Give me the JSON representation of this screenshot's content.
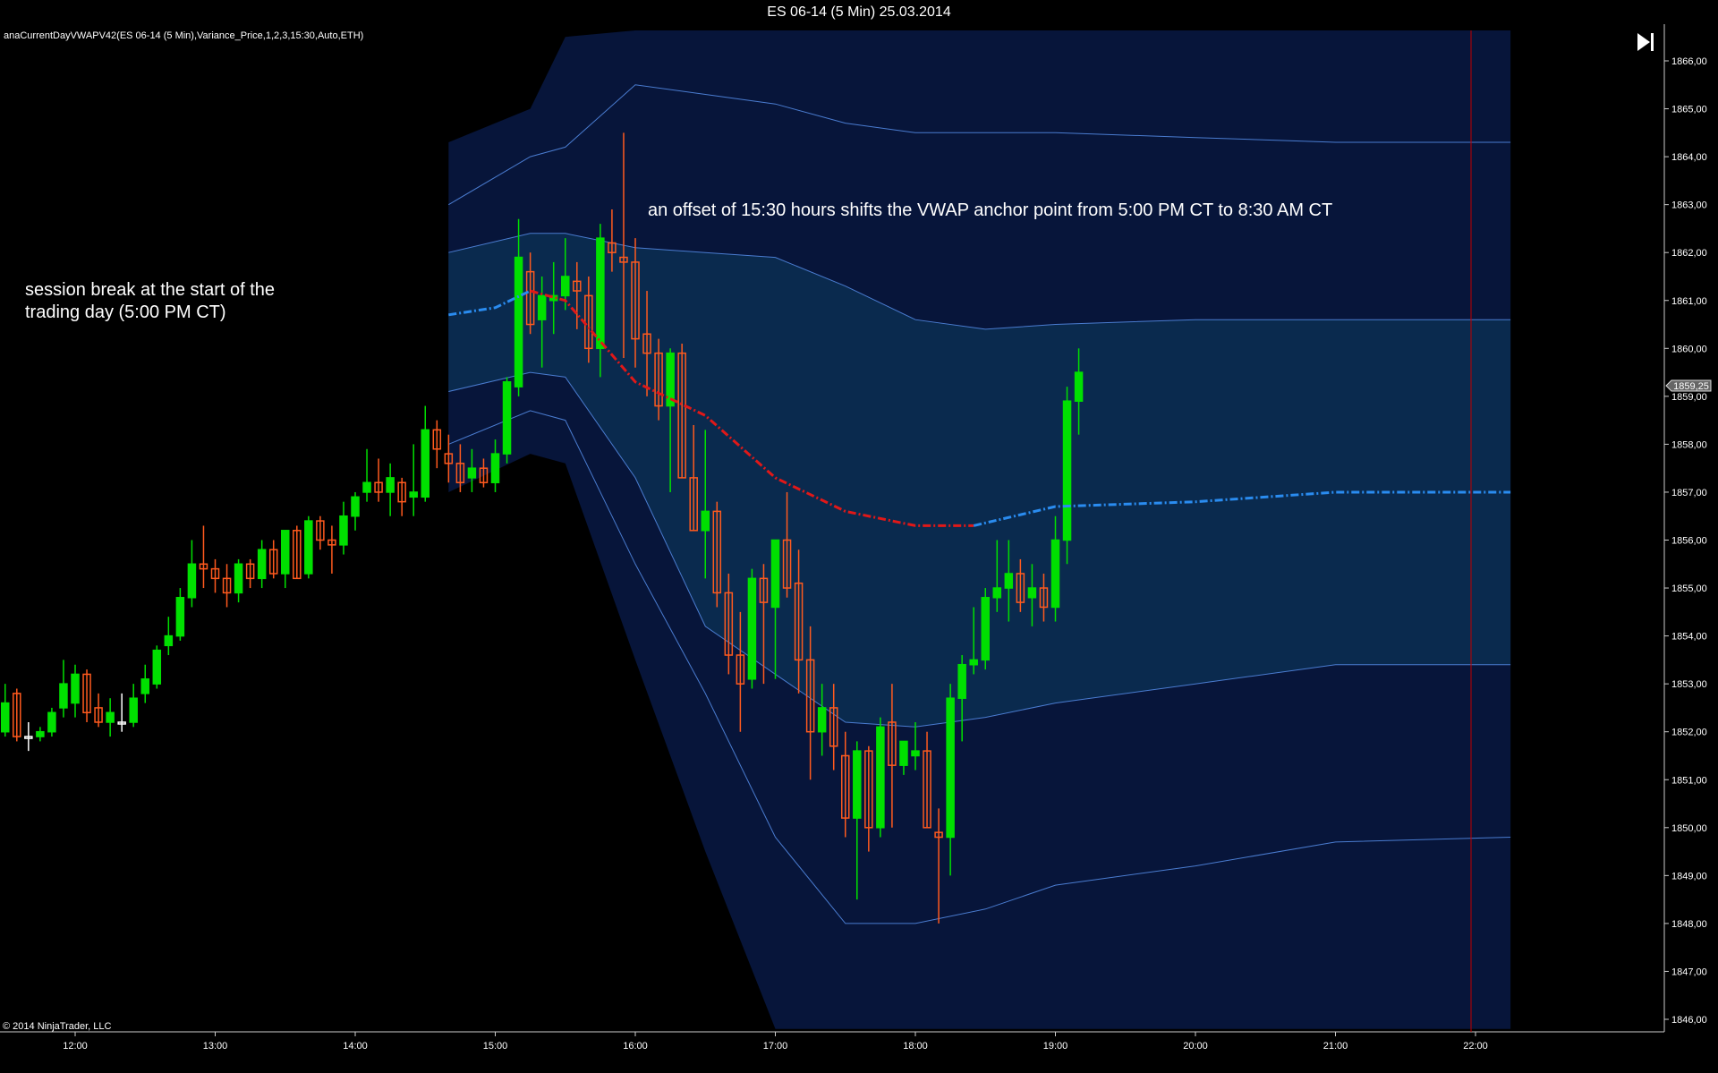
{
  "window_title": "ES 06-14 (5 Min)  25.03.2014",
  "indicator_label": "anaCurrentDayVWAPV42(ES 06-14 (5 Min),Variance_Price,1,2,3,15:30,Auto,ETH)",
  "copyright": "© 2014 NinjaTrader, LLC",
  "go_to_end_icon": "skip-to-end-icon",
  "annotations": {
    "session_break": [
      "session break at the start of the",
      "trading day (5:00 PM CT)"
    ],
    "offset_note": "an offset of 15:30 hours shifts the VWAP anchor point from 5:00 PM CT to 8:30 AM CT"
  },
  "colors": {
    "background": "#000000",
    "up_candle": "#00e000",
    "down_candle": "#ff5a1e",
    "doji_candle": "#ffffff",
    "vwap_before_offset": "#e01818",
    "vwap_after": "#2a8cf0",
    "inner_band": "#0a2a4e",
    "outer_band": "#07153a",
    "band_line": "#4a7cd0",
    "cursor_line": "#c00000"
  },
  "chart_data": {
    "type": "candlestick",
    "interval": "5 Min",
    "x_tick_labels": [
      "12:00",
      "13:00",
      "14:00",
      "15:00",
      "16:00",
      "17:00",
      "18:00",
      "19:00",
      "20:00",
      "21:00",
      "22:00"
    ],
    "y_tick_labels": [
      "1846,00",
      "1847,00",
      "1848,00",
      "1849,00",
      "1850,00",
      "1851,00",
      "1852,00",
      "1853,00",
      "1854,00",
      "1855,00",
      "1856,00",
      "1857,00",
      "1858,00",
      "1859,00",
      "1860,00",
      "1861,00",
      "1862,00",
      "1863,00",
      "1864,00",
      "1865,00",
      "1866,00"
    ],
    "ylim": [
      1845.8,
      1867.0
    ],
    "last_price": "1859,25",
    "vwap": [
      {
        "t": "14:40",
        "v": 1860.7
      },
      {
        "t": "15:00",
        "v": 1860.85
      },
      {
        "t": "15:15",
        "v": 1861.2
      },
      {
        "t": "15:30",
        "v": 1861.0
      },
      {
        "t": "16:00",
        "v": 1859.3
      },
      {
        "t": "16:30",
        "v": 1858.6
      },
      {
        "t": "17:00",
        "v": 1857.3
      },
      {
        "t": "17:30",
        "v": 1856.6
      },
      {
        "t": "18:00",
        "v": 1856.3
      },
      {
        "t": "18:25",
        "v": 1856.3
      },
      {
        "t": "19:00",
        "v": 1856.7
      },
      {
        "t": "20:00",
        "v": 1856.8
      },
      {
        "t": "21:00",
        "v": 1857.0
      },
      {
        "t": "22:15",
        "v": 1857.0
      }
    ],
    "band_1": [
      {
        "t": "14:40",
        "lo": 1859.1,
        "hi": 1862.0
      },
      {
        "t": "15:15",
        "lo": 1859.5,
        "hi": 1862.4
      },
      {
        "t": "15:30",
        "lo": 1859.4,
        "hi": 1862.4
      },
      {
        "t": "16:00",
        "lo": 1857.3,
        "hi": 1862.1
      },
      {
        "t": "16:30",
        "lo": 1854.2,
        "hi": 1862.0
      },
      {
        "t": "17:00",
        "lo": 1853.2,
        "hi": 1861.9
      },
      {
        "t": "17:30",
        "lo": 1852.2,
        "hi": 1861.3
      },
      {
        "t": "18:00",
        "lo": 1852.1,
        "hi": 1860.6
      },
      {
        "t": "18:30",
        "lo": 1852.3,
        "hi": 1860.4
      },
      {
        "t": "19:00",
        "lo": 1852.6,
        "hi": 1860.5
      },
      {
        "t": "20:00",
        "lo": 1853.0,
        "hi": 1860.6
      },
      {
        "t": "21:00",
        "lo": 1853.4,
        "hi": 1860.6
      },
      {
        "t": "22:15",
        "lo": 1853.4,
        "hi": 1860.6
      }
    ],
    "band_2": [
      {
        "t": "14:40",
        "lo": 1858.0,
        "hi": 1863.0
      },
      {
        "t": "15:15",
        "lo": 1858.7,
        "hi": 1864.0
      },
      {
        "t": "15:30",
        "lo": 1858.5,
        "hi": 1864.2
      },
      {
        "t": "16:00",
        "lo": 1855.5,
        "hi": 1865.5
      },
      {
        "t": "16:30",
        "lo": 1852.8,
        "hi": 1865.3
      },
      {
        "t": "17:00",
        "lo": 1849.8,
        "hi": 1865.1
      },
      {
        "t": "17:30",
        "lo": 1848.0,
        "hi": 1864.7
      },
      {
        "t": "18:00",
        "lo": 1848.0,
        "hi": 1864.5
      },
      {
        "t": "18:30",
        "lo": 1848.3,
        "hi": 1864.5
      },
      {
        "t": "19:00",
        "lo": 1848.8,
        "hi": 1864.5
      },
      {
        "t": "20:00",
        "lo": 1849.2,
        "hi": 1864.4
      },
      {
        "t": "21:00",
        "lo": 1849.7,
        "hi": 1864.3
      },
      {
        "t": "22:15",
        "lo": 1849.8,
        "hi": 1864.3
      }
    ],
    "band_3": [
      {
        "t": "14:40",
        "lo": 1857.0,
        "hi": 1864.3
      },
      {
        "t": "15:15",
        "lo": 1857.8,
        "hi": 1865.0
      },
      {
        "t": "15:30",
        "lo": 1857.6,
        "hi": 1866.5
      },
      {
        "t": "16:00",
        "lo": 1853.5,
        "hi": 1867.0
      },
      {
        "t": "16:30",
        "lo": 1849.5,
        "hi": 1867.0
      },
      {
        "t": "17:00",
        "lo": 1845.8,
        "hi": 1867.0
      },
      {
        "t": "22:15",
        "lo": 1845.8,
        "hi": 1867.0
      }
    ],
    "candles": [
      {
        "t": "11:30",
        "o": 1852.0,
        "h": 1853.0,
        "l": 1851.9,
        "c": 1852.6
      },
      {
        "t": "11:35",
        "o": 1852.8,
        "h": 1852.9,
        "l": 1851.8,
        "c": 1851.9
      },
      {
        "t": "11:40",
        "o": 1851.9,
        "h": 1852.2,
        "l": 1851.6,
        "c": 1851.9
      },
      {
        "t": "11:45",
        "o": 1851.9,
        "h": 1852.1,
        "l": 1851.8,
        "c": 1852.0
      },
      {
        "t": "11:50",
        "o": 1852.0,
        "h": 1852.5,
        "l": 1851.9,
        "c": 1852.4
      },
      {
        "t": "11:55",
        "o": 1852.5,
        "h": 1853.5,
        "l": 1852.3,
        "c": 1853.0
      },
      {
        "t": "12:00",
        "o": 1852.6,
        "h": 1853.4,
        "l": 1852.3,
        "c": 1853.2
      },
      {
        "t": "12:05",
        "o": 1853.2,
        "h": 1853.3,
        "l": 1852.2,
        "c": 1852.4
      },
      {
        "t": "12:10",
        "o": 1852.5,
        "h": 1852.8,
        "l": 1852.1,
        "c": 1852.2
      },
      {
        "t": "12:15",
        "o": 1852.2,
        "h": 1852.7,
        "l": 1851.9,
        "c": 1852.4
      },
      {
        "t": "12:20",
        "o": 1852.2,
        "h": 1852.8,
        "l": 1852.0,
        "c": 1852.2
      },
      {
        "t": "12:25",
        "o": 1852.2,
        "h": 1853.0,
        "l": 1852.1,
        "c": 1852.7
      },
      {
        "t": "12:30",
        "o": 1852.8,
        "h": 1853.4,
        "l": 1852.6,
        "c": 1853.1
      },
      {
        "t": "12:35",
        "o": 1853.0,
        "h": 1853.8,
        "l": 1852.9,
        "c": 1853.7
      },
      {
        "t": "12:40",
        "o": 1853.8,
        "h": 1854.4,
        "l": 1853.6,
        "c": 1854.0
      },
      {
        "t": "12:45",
        "o": 1854.0,
        "h": 1855.0,
        "l": 1853.9,
        "c": 1854.8
      },
      {
        "t": "12:50",
        "o": 1854.8,
        "h": 1856.0,
        "l": 1854.6,
        "c": 1855.5
      },
      {
        "t": "12:55",
        "o": 1855.5,
        "h": 1856.3,
        "l": 1855.0,
        "c": 1855.4
      },
      {
        "t": "13:00",
        "o": 1855.4,
        "h": 1855.6,
        "l": 1854.9,
        "c": 1855.2
      },
      {
        "t": "13:05",
        "o": 1855.2,
        "h": 1855.5,
        "l": 1854.6,
        "c": 1854.9
      },
      {
        "t": "13:10",
        "o": 1854.9,
        "h": 1855.6,
        "l": 1854.7,
        "c": 1855.5
      },
      {
        "t": "13:15",
        "o": 1855.5,
        "h": 1855.6,
        "l": 1855.0,
        "c": 1855.2
      },
      {
        "t": "13:20",
        "o": 1855.2,
        "h": 1856.0,
        "l": 1855.0,
        "c": 1855.8
      },
      {
        "t": "13:25",
        "o": 1855.8,
        "h": 1856.0,
        "l": 1855.2,
        "c": 1855.3
      },
      {
        "t": "13:30",
        "o": 1855.3,
        "h": 1856.2,
        "l": 1855.0,
        "c": 1856.2
      },
      {
        "t": "13:35",
        "o": 1856.2,
        "h": 1856.3,
        "l": 1855.2,
        "c": 1855.2
      },
      {
        "t": "13:40",
        "o": 1855.3,
        "h": 1856.5,
        "l": 1855.2,
        "c": 1856.4
      },
      {
        "t": "13:45",
        "o": 1856.4,
        "h": 1856.5,
        "l": 1855.8,
        "c": 1856.0
      },
      {
        "t": "13:50",
        "o": 1856.0,
        "h": 1856.3,
        "l": 1855.3,
        "c": 1855.9
      },
      {
        "t": "13:55",
        "o": 1855.9,
        "h": 1856.8,
        "l": 1855.7,
        "c": 1856.5
      },
      {
        "t": "14:00",
        "o": 1856.5,
        "h": 1857.0,
        "l": 1856.2,
        "c": 1856.9
      },
      {
        "t": "14:05",
        "o": 1857.0,
        "h": 1857.9,
        "l": 1856.8,
        "c": 1857.2
      },
      {
        "t": "14:10",
        "o": 1857.2,
        "h": 1857.7,
        "l": 1856.8,
        "c": 1857.0
      },
      {
        "t": "14:15",
        "o": 1857.0,
        "h": 1857.6,
        "l": 1856.5,
        "c": 1857.3
      },
      {
        "t": "14:20",
        "o": 1857.2,
        "h": 1857.3,
        "l": 1856.5,
        "c": 1856.8
      },
      {
        "t": "14:25",
        "o": 1856.9,
        "h": 1858.0,
        "l": 1856.5,
        "c": 1857.0
      },
      {
        "t": "14:30",
        "o": 1856.9,
        "h": 1858.8,
        "l": 1856.8,
        "c": 1858.3
      },
      {
        "t": "14:35",
        "o": 1858.3,
        "h": 1858.5,
        "l": 1857.5,
        "c": 1857.9
      },
      {
        "t": "14:40",
        "o": 1857.8,
        "h": 1858.2,
        "l": 1857.2,
        "c": 1857.6
      },
      {
        "t": "14:45",
        "o": 1857.6,
        "h": 1858.0,
        "l": 1857.0,
        "c": 1857.2
      },
      {
        "t": "14:50",
        "o": 1857.3,
        "h": 1857.9,
        "l": 1857.0,
        "c": 1857.5
      },
      {
        "t": "14:55",
        "o": 1857.5,
        "h": 1857.7,
        "l": 1857.1,
        "c": 1857.2
      },
      {
        "t": "15:00",
        "o": 1857.2,
        "h": 1858.1,
        "l": 1857.0,
        "c": 1857.8
      },
      {
        "t": "15:05",
        "o": 1857.8,
        "h": 1859.4,
        "l": 1857.6,
        "c": 1859.3
      },
      {
        "t": "15:10",
        "o": 1859.2,
        "h": 1862.7,
        "l": 1859.0,
        "c": 1861.9
      },
      {
        "t": "15:15",
        "o": 1861.6,
        "h": 1862.0,
        "l": 1860.3,
        "c": 1860.5
      },
      {
        "t": "15:20",
        "o": 1860.6,
        "h": 1861.5,
        "l": 1859.6,
        "c": 1861.1
      },
      {
        "t": "15:25",
        "o": 1861.0,
        "h": 1861.8,
        "l": 1860.3,
        "c": 1861.1
      },
      {
        "t": "15:30",
        "o": 1861.1,
        "h": 1862.3,
        "l": 1860.8,
        "c": 1861.5
      },
      {
        "t": "15:35",
        "o": 1861.4,
        "h": 1861.8,
        "l": 1860.4,
        "c": 1861.2
      },
      {
        "t": "15:40",
        "o": 1861.1,
        "h": 1861.5,
        "l": 1859.7,
        "c": 1860.0
      },
      {
        "t": "15:45",
        "o": 1860.0,
        "h": 1862.6,
        "l": 1859.4,
        "c": 1862.3
      },
      {
        "t": "15:50",
        "o": 1862.2,
        "h": 1862.9,
        "l": 1861.6,
        "c": 1862.0
      },
      {
        "t": "15:55",
        "o": 1861.9,
        "h": 1864.5,
        "l": 1859.8,
        "c": 1861.8
      },
      {
        "t": "16:00",
        "o": 1861.8,
        "h": 1862.3,
        "l": 1859.6,
        "c": 1860.2
      },
      {
        "t": "16:05",
        "o": 1860.3,
        "h": 1861.2,
        "l": 1859.0,
        "c": 1859.9
      },
      {
        "t": "16:10",
        "o": 1859.9,
        "h": 1860.2,
        "l": 1858.5,
        "c": 1858.8
      },
      {
        "t": "16:15",
        "o": 1858.8,
        "h": 1860.0,
        "l": 1857.0,
        "c": 1859.9
      },
      {
        "t": "16:20",
        "o": 1859.9,
        "h": 1860.1,
        "l": 1857.3,
        "c": 1857.3
      },
      {
        "t": "16:25",
        "o": 1857.3,
        "h": 1858.4,
        "l": 1856.2,
        "c": 1856.2
      },
      {
        "t": "16:30",
        "o": 1856.2,
        "h": 1858.3,
        "l": 1855.2,
        "c": 1856.6
      },
      {
        "t": "16:35",
        "o": 1856.6,
        "h": 1856.8,
        "l": 1854.6,
        "c": 1854.9
      },
      {
        "t": "16:40",
        "o": 1854.9,
        "h": 1855.3,
        "l": 1853.2,
        "c": 1853.6
      },
      {
        "t": "16:45",
        "o": 1853.6,
        "h": 1854.5,
        "l": 1852.0,
        "c": 1853.0
      },
      {
        "t": "16:50",
        "o": 1853.1,
        "h": 1855.4,
        "l": 1852.9,
        "c": 1855.2
      },
      {
        "t": "16:55",
        "o": 1855.2,
        "h": 1855.5,
        "l": 1853.0,
        "c": 1854.7
      },
      {
        "t": "17:00",
        "o": 1854.6,
        "h": 1856.0,
        "l": 1853.1,
        "c": 1856.0
      },
      {
        "t": "17:05",
        "o": 1856.0,
        "h": 1857.0,
        "l": 1854.8,
        "c": 1855.0
      },
      {
        "t": "17:10",
        "o": 1855.1,
        "h": 1855.8,
        "l": 1852.8,
        "c": 1853.5
      },
      {
        "t": "17:15",
        "o": 1853.5,
        "h": 1854.2,
        "l": 1851.0,
        "c": 1852.0
      },
      {
        "t": "17:20",
        "o": 1852.0,
        "h": 1853.0,
        "l": 1851.5,
        "c": 1852.5
      },
      {
        "t": "17:25",
        "o": 1852.5,
        "h": 1853.0,
        "l": 1851.2,
        "c": 1851.7
      },
      {
        "t": "17:30",
        "o": 1851.5,
        "h": 1852.0,
        "l": 1849.8,
        "c": 1850.2
      },
      {
        "t": "17:35",
        "o": 1850.2,
        "h": 1851.8,
        "l": 1848.5,
        "c": 1851.6
      },
      {
        "t": "17:40",
        "o": 1851.6,
        "h": 1851.7,
        "l": 1849.5,
        "c": 1850.0
      },
      {
        "t": "17:45",
        "o": 1850.0,
        "h": 1852.3,
        "l": 1849.8,
        "c": 1852.1
      },
      {
        "t": "17:50",
        "o": 1852.2,
        "h": 1853.0,
        "l": 1850.0,
        "c": 1851.3
      },
      {
        "t": "17:55",
        "o": 1851.3,
        "h": 1851.8,
        "l": 1851.1,
        "c": 1851.8
      },
      {
        "t": "18:00",
        "o": 1851.5,
        "h": 1852.2,
        "l": 1851.2,
        "c": 1851.6
      },
      {
        "t": "18:05",
        "o": 1851.6,
        "h": 1852.0,
        "l": 1850.0,
        "c": 1850.0
      },
      {
        "t": "18:10",
        "o": 1849.9,
        "h": 1850.4,
        "l": 1848.0,
        "c": 1849.8
      },
      {
        "t": "18:15",
        "o": 1849.8,
        "h": 1853.0,
        "l": 1849.0,
        "c": 1852.7
      },
      {
        "t": "18:20",
        "o": 1852.7,
        "h": 1853.6,
        "l": 1851.8,
        "c": 1853.4
      },
      {
        "t": "18:25",
        "o": 1853.4,
        "h": 1854.6,
        "l": 1853.2,
        "c": 1853.5
      },
      {
        "t": "18:30",
        "o": 1853.5,
        "h": 1855.0,
        "l": 1853.3,
        "c": 1854.8
      },
      {
        "t": "18:35",
        "o": 1854.8,
        "h": 1856.0,
        "l": 1854.5,
        "c": 1855.0
      },
      {
        "t": "18:40",
        "o": 1855.0,
        "h": 1856.0,
        "l": 1854.3,
        "c": 1855.3
      },
      {
        "t": "18:45",
        "o": 1855.3,
        "h": 1855.6,
        "l": 1854.5,
        "c": 1854.7
      },
      {
        "t": "18:50",
        "o": 1854.8,
        "h": 1855.5,
        "l": 1854.2,
        "c": 1855.0
      },
      {
        "t": "18:55",
        "o": 1855.0,
        "h": 1855.3,
        "l": 1854.3,
        "c": 1854.6
      },
      {
        "t": "19:00",
        "o": 1854.6,
        "h": 1856.5,
        "l": 1854.3,
        "c": 1856.0
      },
      {
        "t": "19:05",
        "o": 1856.0,
        "h": 1859.2,
        "l": 1855.5,
        "c": 1858.9
      },
      {
        "t": "19:10",
        "o": 1858.9,
        "h": 1860.0,
        "l": 1858.2,
        "c": 1859.5
      }
    ]
  }
}
